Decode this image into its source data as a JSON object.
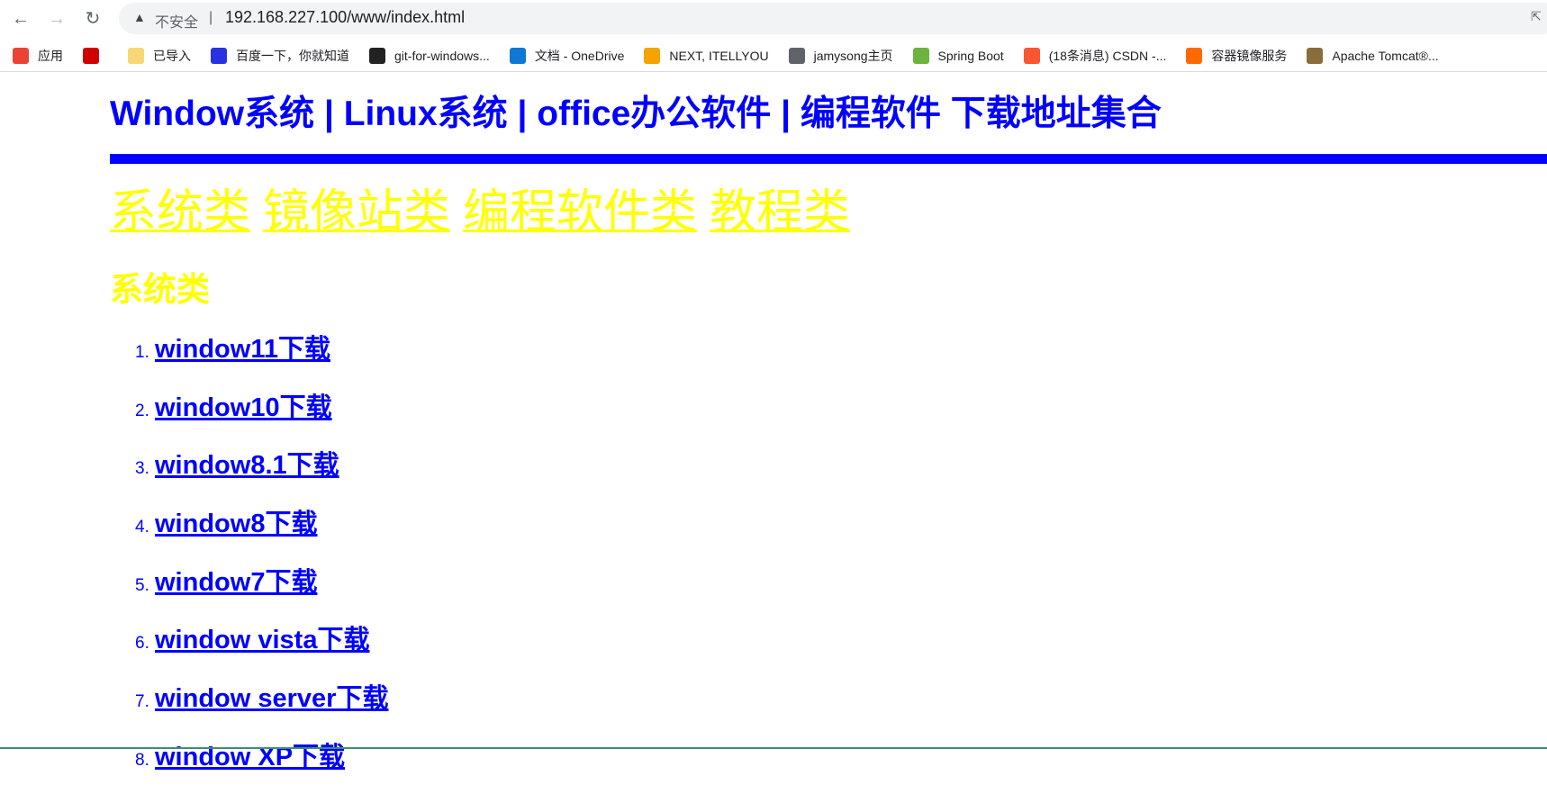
{
  "browser": {
    "back_icon": "arrow-left",
    "forward_icon": "arrow-right",
    "reload_icon": "reload",
    "security_label": "不安全",
    "url": "192.168.227.100/www/index.html",
    "bookmarks": [
      {
        "label": "应用",
        "icon": "apps-grid",
        "color": "#ea4335"
      },
      {
        "label": "",
        "icon": "L-logo",
        "color": "#d00000"
      },
      {
        "label": "已导入",
        "icon": "folder",
        "color": "#f8d775"
      },
      {
        "label": "百度一下，你就知道",
        "icon": "baidu-paw",
        "color": "#2932e1"
      },
      {
        "label": "git-for-windows...",
        "icon": "git-logo",
        "color": "#222222"
      },
      {
        "label": "文档 - OneDrive",
        "icon": "cloud",
        "color": "#0f78d4"
      },
      {
        "label": "NEXT, ITELLYOU",
        "icon": "itellyou-logo",
        "color": "#f4a300"
      },
      {
        "label": "jamysong主页",
        "icon": "globe",
        "color": "#5f6368"
      },
      {
        "label": "Spring Boot",
        "icon": "spring-leaf",
        "color": "#6db33f"
      },
      {
        "label": "(18条消息) CSDN -...",
        "icon": "csdn-c",
        "color": "#fc5531"
      },
      {
        "label": "容器镜像服务",
        "icon": "aliyun-logo",
        "color": "#ff6a00"
      },
      {
        "label": "Apache Tomcat®...",
        "icon": "tomcat-logo",
        "color": "#8a6d3b"
      }
    ]
  },
  "page": {
    "title": "Window系统 | Linux系统 | office办公软件 | 编程软件 下载地址集合",
    "nav": [
      "系统类",
      "镜像站类",
      "编程软件类",
      "教程类"
    ],
    "section_title": "系统类",
    "items": [
      {
        "num": "1.",
        "label": "window11下载"
      },
      {
        "num": "2.",
        "label": "window10下载"
      },
      {
        "num": "3.",
        "label": "window8.1下载"
      },
      {
        "num": "4.",
        "label": "window8下载"
      },
      {
        "num": "5.",
        "label": "window7下载"
      },
      {
        "num": "6.",
        "label": "window vista下载"
      },
      {
        "num": "7.",
        "label": "window server下载"
      },
      {
        "num": "8.",
        "label": "window XP下载"
      }
    ]
  },
  "colors": {
    "link": "#0000ff",
    "nav_link": "#ffff00"
  }
}
